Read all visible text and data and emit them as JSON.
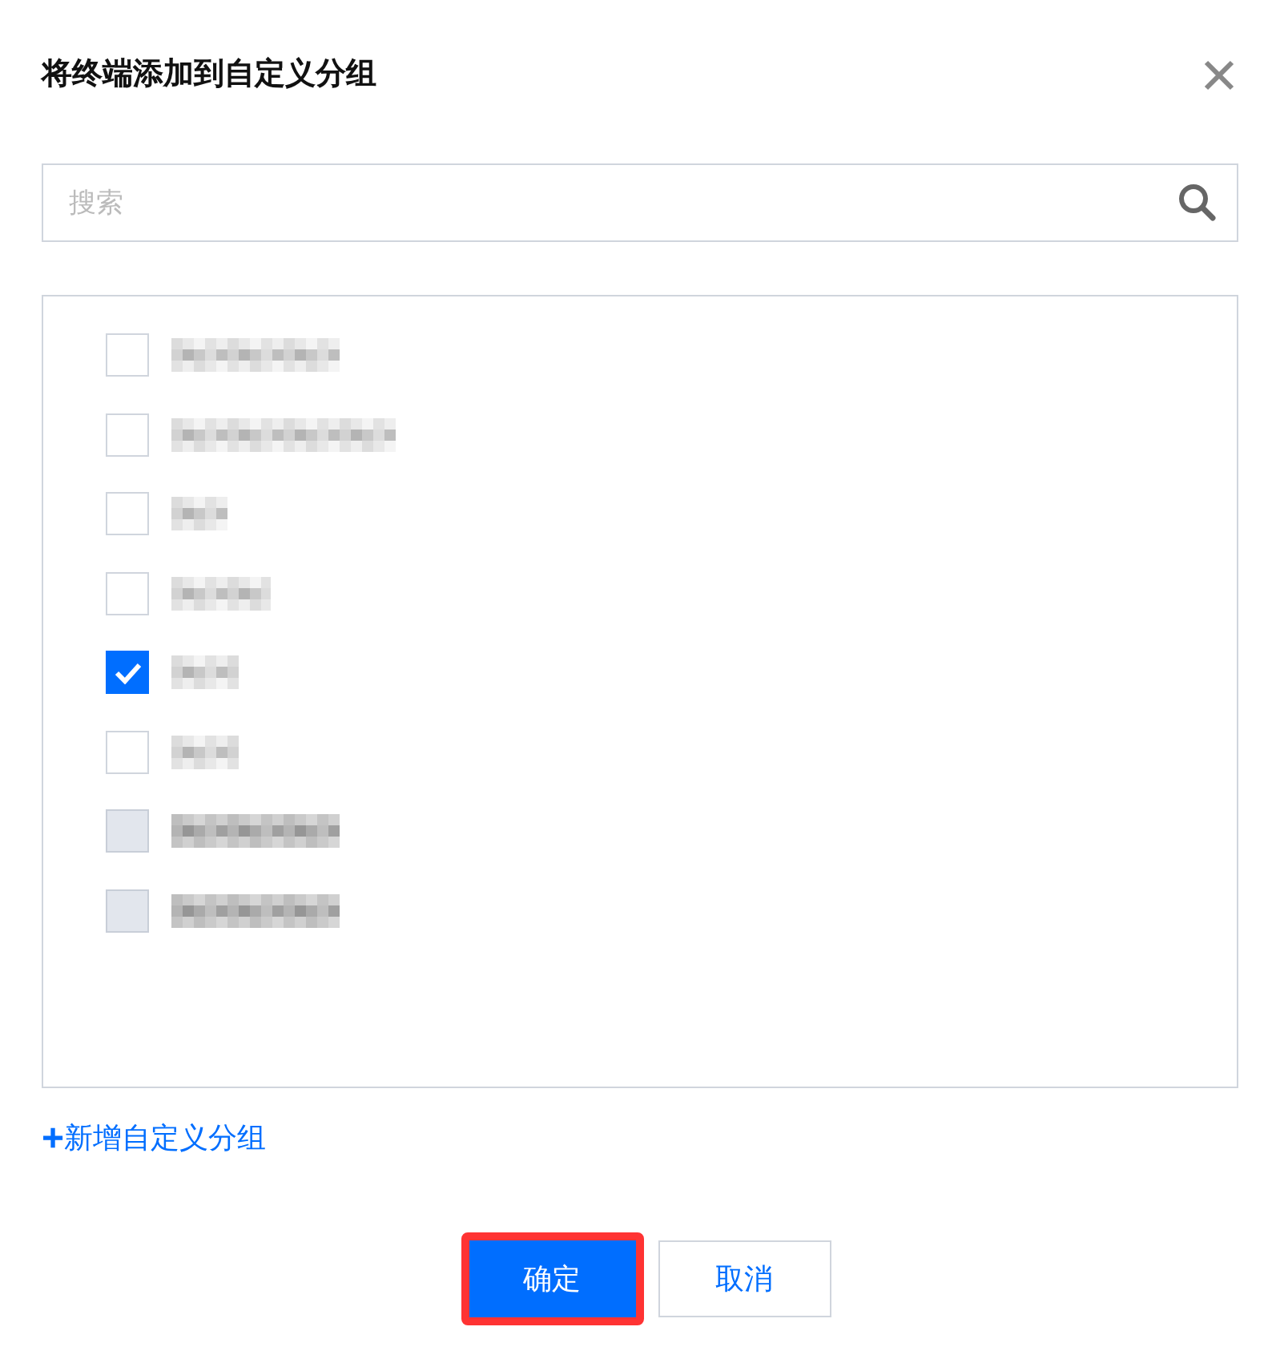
{
  "dialog": {
    "title": "将终端添加到自定义分组"
  },
  "search": {
    "placeholder": "搜索"
  },
  "groups": [
    {
      "checked": false,
      "disabled": false
    },
    {
      "checked": false,
      "disabled": false
    },
    {
      "checked": false,
      "disabled": false
    },
    {
      "checked": false,
      "disabled": false
    },
    {
      "checked": true,
      "disabled": false
    },
    {
      "checked": false,
      "disabled": false
    },
    {
      "checked": false,
      "disabled": true
    },
    {
      "checked": false,
      "disabled": true
    }
  ],
  "add_link": {
    "icon": "+",
    "label": "新增自定义分组"
  },
  "buttons": [
    {
      "label": "确定",
      "kind": "primary",
      "highlighted": true
    },
    {
      "label": "取消",
      "kind": "secondary",
      "highlighted": false
    }
  ]
}
